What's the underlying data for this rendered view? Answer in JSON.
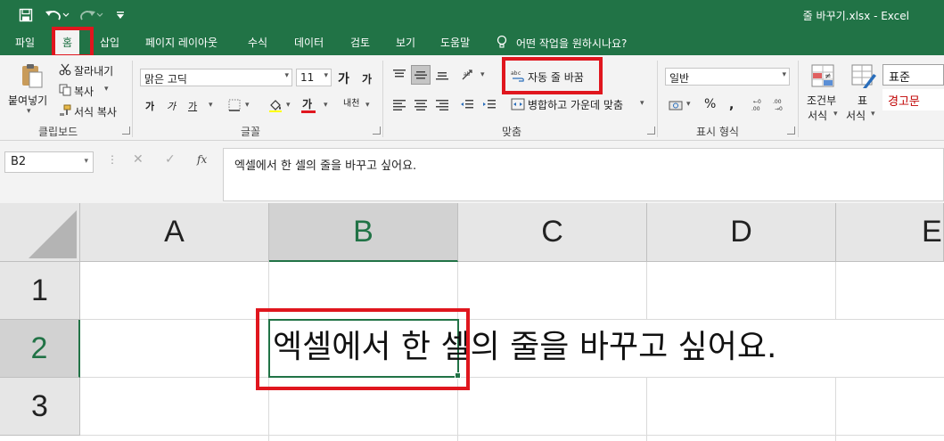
{
  "window": {
    "title": "줄 바꾸기.xlsx  -  Excel"
  },
  "qat": {
    "save_icon": "save-icon",
    "undo_icon": "undo-icon",
    "redo_icon": "redo-icon",
    "customize_icon": "customize-qat-icon"
  },
  "tabs": [
    {
      "label": "파일"
    },
    {
      "label": "홈"
    },
    {
      "label": "삽입"
    },
    {
      "label": "페이지 레이아웃"
    },
    {
      "label": "수식"
    },
    {
      "label": "데이터"
    },
    {
      "label": "검토"
    },
    {
      "label": "보기"
    },
    {
      "label": "도움말"
    }
  ],
  "tell_me": {
    "label": "어떤 작업을 원하시나요?"
  },
  "clipboard": {
    "paste": "붙여넣기",
    "cut": "잘라내기",
    "copy": "복사",
    "format_painter": "서식 복사",
    "group": "클립보드"
  },
  "font": {
    "name": "맑은 고딕",
    "size": "11",
    "increase": "가",
    "decrease": "가",
    "bold": "가",
    "italic": "가",
    "underline": "가",
    "font_color": "가",
    "phonetic": "내천",
    "group": "글꼴"
  },
  "alignment": {
    "wrap_text": "자동 줄 바꿈",
    "merge_center": "병합하고 가운데 맞춤",
    "group": "맞춤"
  },
  "number": {
    "format": "일반",
    "group": "표시 형식"
  },
  "styles": {
    "conditional": "조건부",
    "conditional2": "서식",
    "table": "표",
    "table2": "서식",
    "normal": "표준",
    "warning": "경고문"
  },
  "formula_bar": {
    "name_box": "B2",
    "fx": "fx",
    "content": "엑셀에서 한 셀의 줄을 바꾸고 싶어요."
  },
  "sheet": {
    "columns": [
      "A",
      "B",
      "C",
      "D",
      "E"
    ],
    "rows": [
      "1",
      "2",
      "3"
    ],
    "b2": "엑셀에서 한 셀의 줄을 바꾸고 싶어요."
  },
  "colors": {
    "excel_green": "#217346",
    "highlight_red": "#e0161e",
    "warning_red": "#c00000"
  }
}
